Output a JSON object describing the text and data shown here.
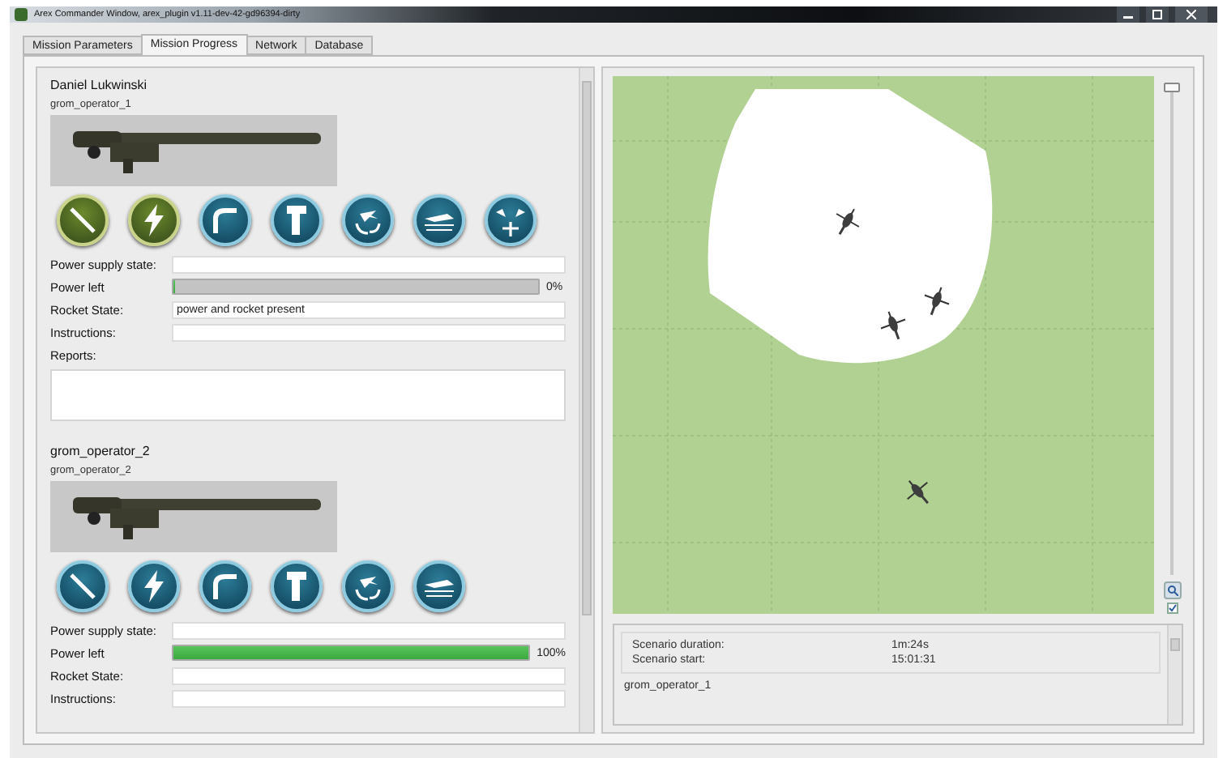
{
  "window": {
    "title": "Arex Commander Window, arex_plugin v1.11-dev-42-gd96394-dirty"
  },
  "tabs": [
    {
      "label": "Mission Parameters",
      "selected": false
    },
    {
      "label": "Mission Progress",
      "selected": true
    },
    {
      "label": "Network",
      "selected": false
    },
    {
      "label": "Database",
      "selected": false
    }
  ],
  "operators": [
    {
      "name": "Daniel Lukwinski",
      "subtitle": "grom_operator_1",
      "buttons": [
        {
          "kind": "rod",
          "active": true
        },
        {
          "kind": "bolt",
          "active": true
        },
        {
          "kind": "hook",
          "active": false
        },
        {
          "kind": "grip",
          "active": false
        },
        {
          "kind": "plane-cycle",
          "active": false
        },
        {
          "kind": "plane-sea",
          "active": false
        },
        {
          "kind": "planes",
          "active": false
        }
      ],
      "fields": [
        {
          "kind": "text",
          "label": "Power supply state:"
        },
        {
          "kind": "progress",
          "label": "Power left",
          "level": 0,
          "reading": "0%"
        },
        {
          "kind": "text",
          "label": "Rocket State:",
          "value": "power and rocket present"
        },
        {
          "kind": "text",
          "label": "Instructions:"
        },
        {
          "kind": "area",
          "label": "Reports:"
        }
      ]
    },
    {
      "name": "grom_operator_2",
      "subtitle": "grom_operator_2",
      "buttons": [
        {
          "kind": "rod",
          "active": false
        },
        {
          "kind": "bolt",
          "active": false
        },
        {
          "kind": "hook",
          "active": false
        },
        {
          "kind": "grip",
          "active": false
        },
        {
          "kind": "plane-cycle",
          "active": false
        },
        {
          "kind": "plane-sea",
          "active": false
        }
      ],
      "fields": [
        {
          "kind": "text",
          "label": "Power supply state:"
        },
        {
          "kind": "progress",
          "label": "Power left",
          "level": 1,
          "reading": "100%"
        },
        {
          "kind": "text",
          "label": "Rocket State:"
        },
        {
          "kind": "text",
          "label": "Instructions:"
        }
      ]
    }
  ],
  "map": {
    "zoom": {
      "level": 1
    },
    "overlay_checked": true
  },
  "summary": [
    {
      "label": "Scenario duration:",
      "value": "1m:24s"
    },
    {
      "label": "Scenario start:",
      "value": "15:01:31"
    }
  ],
  "section_title": "grom_operator_1"
}
